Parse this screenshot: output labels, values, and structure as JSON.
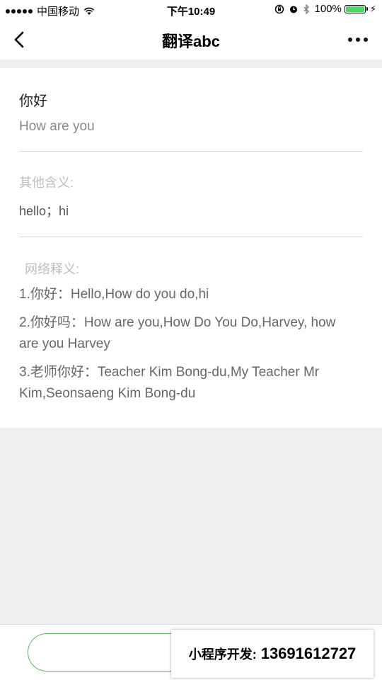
{
  "status_bar": {
    "carrier": "中国移动",
    "time": "下午10:49",
    "battery": "100%",
    "battery_color": "#4cd964",
    "battery_level": 1.0,
    "icons": [
      "signal-icon",
      "wifi-icon",
      "rotation-lock-icon",
      "alarm-icon",
      "bluetooth-icon",
      "battery-icon",
      "charging-icon"
    ]
  },
  "nav": {
    "title": "翻译abc",
    "back_icon": "chevron-left-icon",
    "more_icon": "more-dots-icon"
  },
  "result": {
    "word": "你好",
    "translation": "How are you",
    "other_meanings_label": "其他含义:",
    "other_meanings": "hello；hi",
    "web_meanings_label": "网络释义:",
    "web_meanings": [
      "1.你好：Hello,How do you do,hi",
      "2.你好吗：How are you,How Do You Do,Harvey, how are you Harvey",
      "3.老师你好：Teacher Kim Bong-du,My Teacher Mr Kim,Seonsaeng Kim Bong-du"
    ]
  },
  "bottom": {
    "input_value": "",
    "accent_color": "#5cb85c"
  },
  "watermark": {
    "label": "小程序开发:",
    "phone": "13691612727"
  }
}
